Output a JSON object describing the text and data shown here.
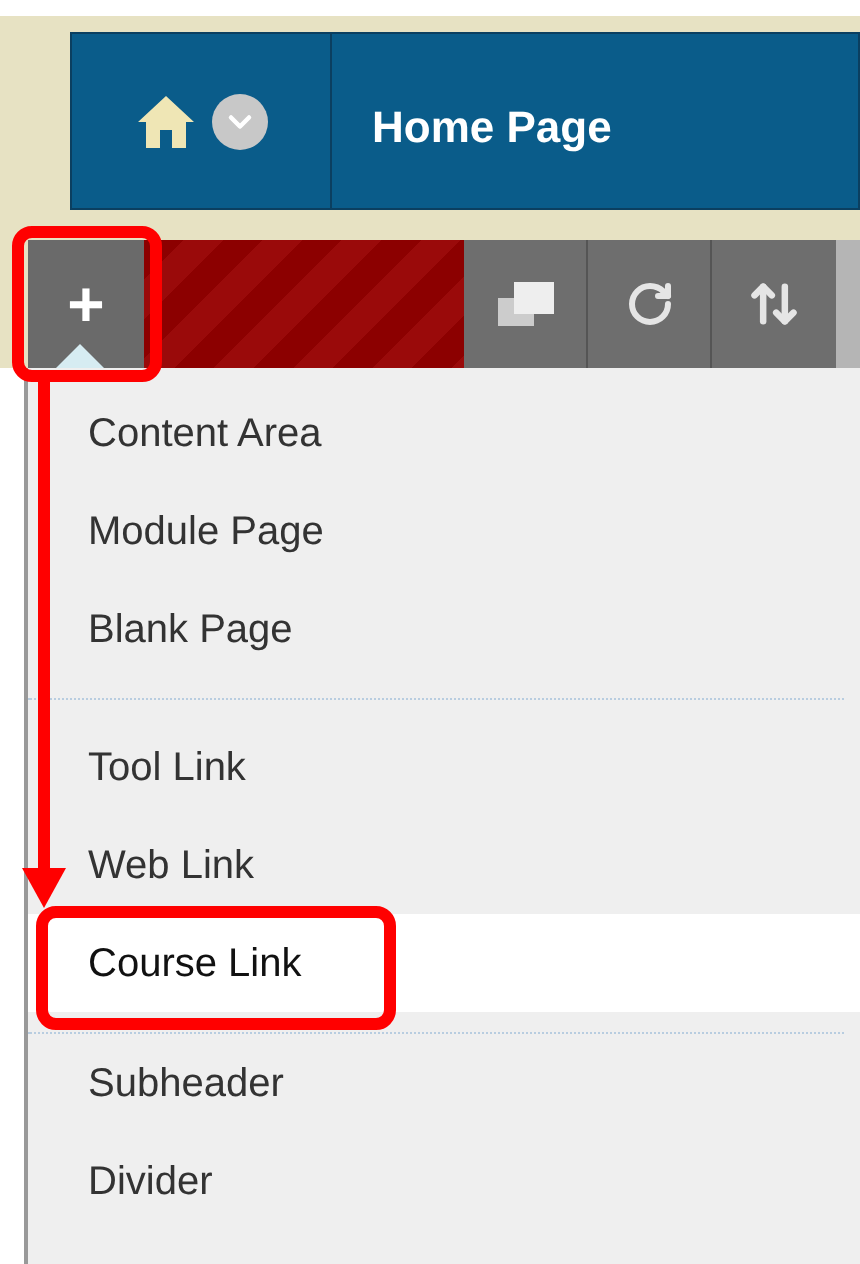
{
  "header": {
    "title": "Home Page"
  },
  "toolbar": {
    "add_button": "+"
  },
  "menu": {
    "groups": [
      {
        "items": [
          {
            "label": "Content Area",
            "selected": false
          },
          {
            "label": "Module Page",
            "selected": false
          },
          {
            "label": "Blank Page",
            "selected": false
          }
        ]
      },
      {
        "items": [
          {
            "label": "Tool Link",
            "selected": false
          },
          {
            "label": "Web Link",
            "selected": false
          },
          {
            "label": "Course Link",
            "selected": true
          }
        ]
      },
      {
        "items": [
          {
            "label": "Subheader",
            "selected": false
          },
          {
            "label": "Divider",
            "selected": false
          }
        ]
      }
    ]
  }
}
